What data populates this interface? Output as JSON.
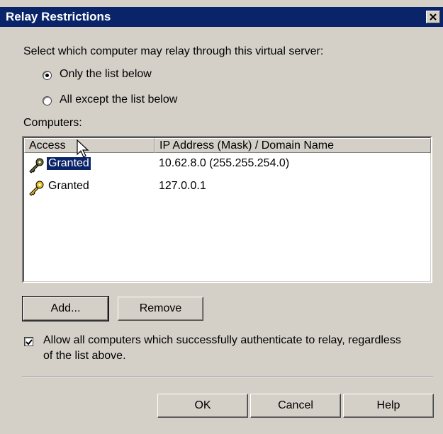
{
  "window": {
    "title": "Relay Restrictions"
  },
  "instruction": "Select which computer may relay through this virtual server:",
  "radios": [
    {
      "label": "Only the list below",
      "selected": true
    },
    {
      "label": "All except the list below",
      "selected": false
    }
  ],
  "computers_label": "Computers:",
  "columns": {
    "access": "Access",
    "ip": "IP Address (Mask) / Domain Name"
  },
  "rows": [
    {
      "access": "Granted",
      "ip": "10.62.8.0 (255.255.254.0)",
      "selected": true,
      "icon": "key-icon"
    },
    {
      "access": "Granted",
      "ip": "127.0.0.1",
      "selected": false,
      "icon": "key-icon"
    }
  ],
  "buttons": {
    "add": "Add...",
    "remove": "Remove",
    "ok": "OK",
    "cancel": "Cancel",
    "help": "Help"
  },
  "checkbox": {
    "checked": true,
    "line1": "Allow all computers which successfully authenticate to relay, regardless",
    "line2": "of the list above."
  },
  "colors": {
    "title_bar": "#0a246a",
    "dialog_bg": "#d4d0c8",
    "selection": "#0a246a"
  }
}
